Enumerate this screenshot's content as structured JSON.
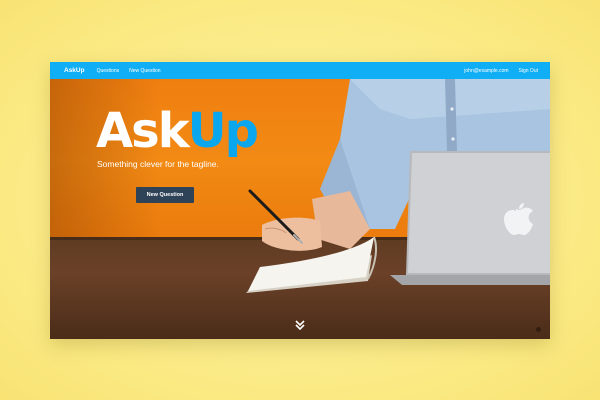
{
  "navbar": {
    "brand": "AskUp",
    "links": [
      "Questions",
      "New Question"
    ],
    "user_email": "john@example.com",
    "sign_out": "Sign Out"
  },
  "hero": {
    "title_part1": "Ask",
    "title_part2": "Up",
    "tagline": "Something clever for the tagline.",
    "cta_label": "New Question"
  },
  "icons": {
    "scroll": "chevron-double-down-icon",
    "laptop_logo": "apple-logo-icon"
  },
  "colors": {
    "navbar": "#10aef5",
    "accent_blue": "#0aa7ef",
    "cta": "#2f4358",
    "wall": "#f07f10",
    "background": "#fbea83"
  }
}
